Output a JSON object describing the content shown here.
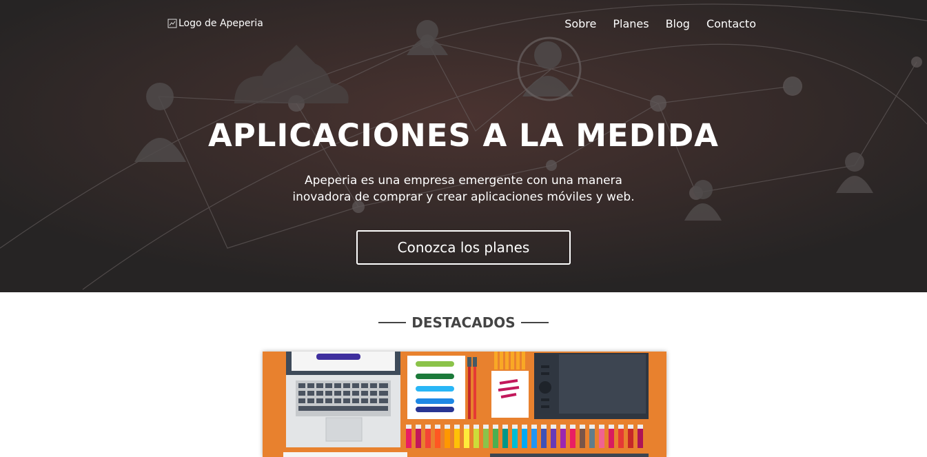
{
  "header": {
    "logo_alt": "Logo de Apeperia",
    "nav": [
      {
        "label": "Sobre"
      },
      {
        "label": "Planes"
      },
      {
        "label": "Blog"
      },
      {
        "label": "Contacto"
      }
    ]
  },
  "hero": {
    "title": "APLICACIONES A LA MEDIDA",
    "subtitle_line1": "Apeperia es una empresa emergente con una manera",
    "subtitle_line2": "inovadora de comprar y crear aplicaciones móviles y web.",
    "cta_label": "Conozca los planes"
  },
  "featured": {
    "title": "DESTACADOS"
  },
  "colors": {
    "hero_bg": "#2c2a2a",
    "featured_orange": "#e8812e",
    "text_dark": "#444444"
  }
}
